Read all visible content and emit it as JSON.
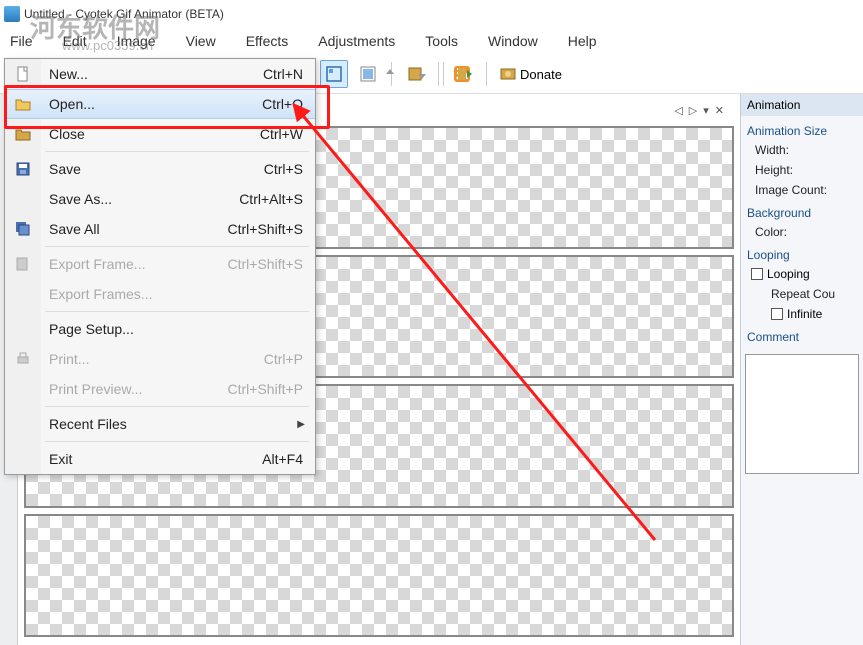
{
  "title": "Untitled - Cyotek Gif Animator (BETA)",
  "watermark": "河东软件网",
  "watermark_url": "www.pc0359.cn",
  "menubar": [
    "File",
    "Edit",
    "Image",
    "View",
    "Effects",
    "Adjustments",
    "Tools",
    "Window",
    "Help"
  ],
  "toolbar": {
    "donate": "Donate"
  },
  "file_menu": [
    {
      "label": "New...",
      "shortcut": "Ctrl+N",
      "icon": "new"
    },
    {
      "label": "Open...",
      "shortcut": "Ctrl+O",
      "icon": "open",
      "hover": true
    },
    {
      "label": "Close",
      "shortcut": "Ctrl+W",
      "icon": "close"
    },
    "-",
    {
      "label": "Save",
      "shortcut": "Ctrl+S",
      "icon": "save"
    },
    {
      "label": "Save As...",
      "shortcut": "Ctrl+Alt+S"
    },
    {
      "label": "Save All",
      "shortcut": "Ctrl+Shift+S",
      "icon": "saveall"
    },
    "-",
    {
      "label": "Export Frame...",
      "shortcut": "Ctrl+Shift+S",
      "disabled": true,
      "icon": "exportf"
    },
    {
      "label": "Export Frames...",
      "disabled": true
    },
    "-",
    {
      "label": "Page Setup..."
    },
    {
      "label": "Print...",
      "shortcut": "Ctrl+P",
      "disabled": true,
      "icon": "print"
    },
    {
      "label": "Print Preview...",
      "shortcut": "Ctrl+Shift+P",
      "disabled": true
    },
    "-",
    {
      "label": "Recent Files",
      "submenu": true
    },
    "-",
    {
      "label": "Exit",
      "shortcut": "Alt+F4"
    }
  ],
  "frames_header": {
    "prev": "◁",
    "next": "▷",
    "pin": "▾",
    "close": "✕"
  },
  "panel": {
    "title": "Animation",
    "section1": "Animation Size",
    "width": "Width:",
    "height": "Height:",
    "image_count": "Image Count:",
    "section2": "Background",
    "color": "Color:",
    "section3": "Looping",
    "looping": "Looping",
    "repeat": "Repeat Cou",
    "infinite": "Infinite",
    "section4": "Comment"
  }
}
